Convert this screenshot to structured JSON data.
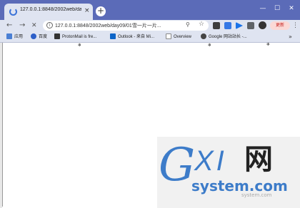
{
  "tab": {
    "title": "127.0.0.1:8848/2002web/day09/",
    "close": "×"
  },
  "window": {
    "minimize": "—",
    "maximize": "☐",
    "close": "✕"
  },
  "toolbar": {
    "back": "←",
    "forward": "→",
    "stop": "✕",
    "url": "127.0.0.1:8848/2002web/day09/01雪一片一片...",
    "update_label": "更新",
    "menu": "⋮"
  },
  "bookmarks": {
    "items": [
      {
        "label": "应用",
        "color": "#4a7fd4"
      },
      {
        "label": "百度",
        "color": "#2d5fc8"
      },
      {
        "label": "ProtonMail is fre...",
        "color": "#333"
      },
      {
        "label": "Outlook - 来自 Mi...",
        "color": "#0a64c8"
      },
      {
        "label": "Overview",
        "color": "#555"
      },
      {
        "label": "Google 网站站长 -...",
        "color": "#444"
      }
    ],
    "more": "»"
  },
  "page": {
    "snowflake": "❄"
  },
  "watermark": {
    "g": "G",
    "xi": "XI",
    "wang": "网",
    "domain": "system.com",
    "sub": "system.com"
  }
}
